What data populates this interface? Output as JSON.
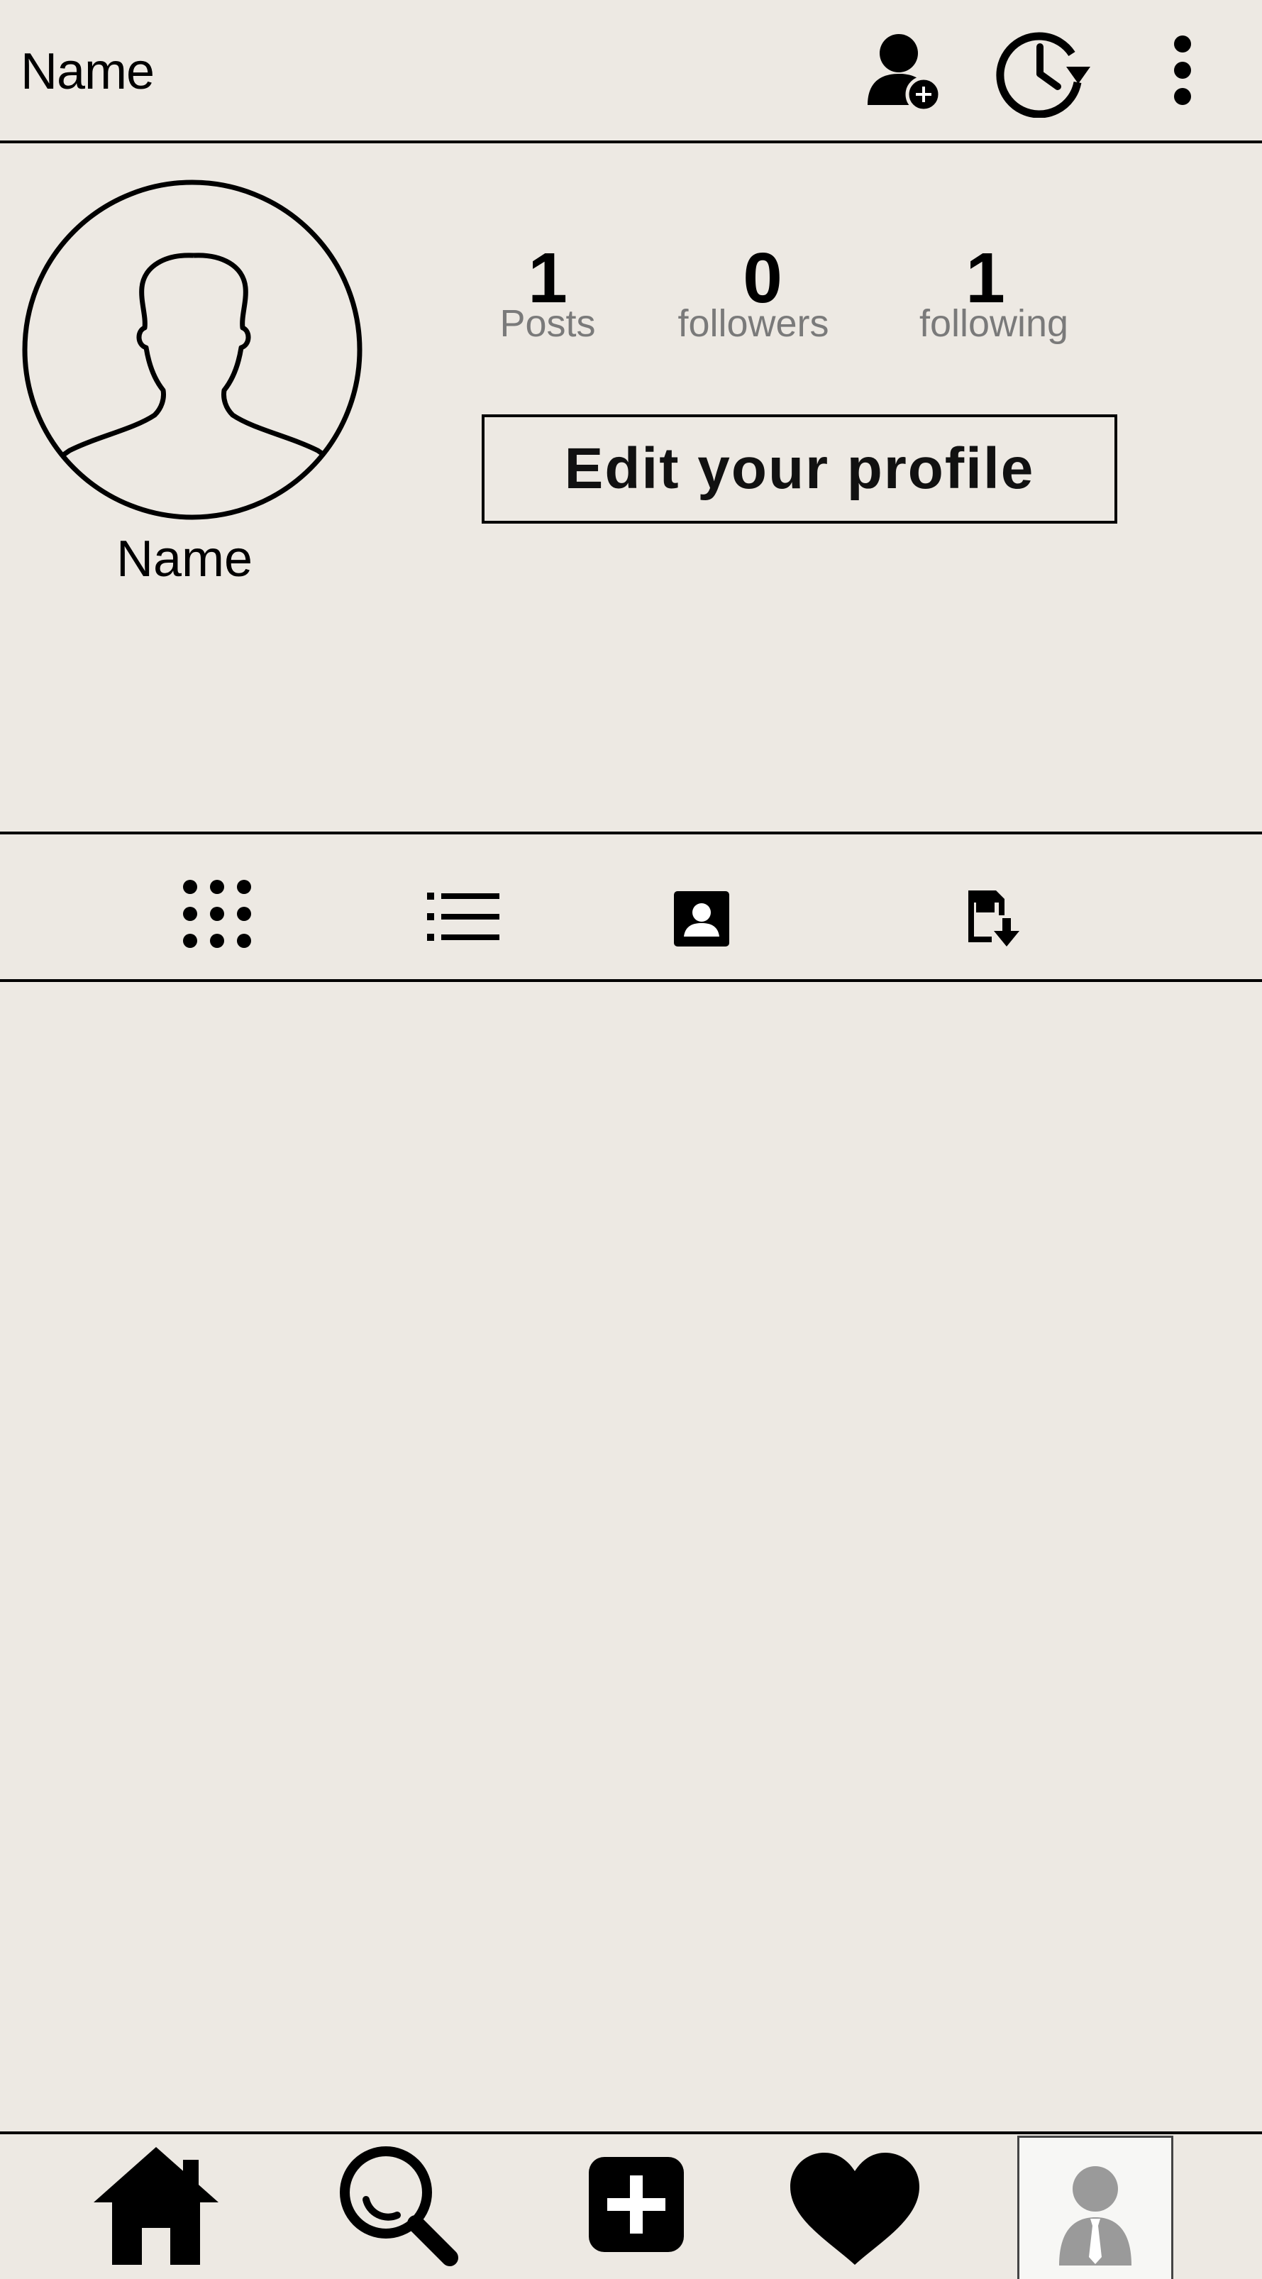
{
  "header": {
    "title": "Name",
    "icons": [
      "add-user-icon",
      "history-icon",
      "more-vertical-icon"
    ]
  },
  "profile": {
    "name": "Name",
    "stats": [
      {
        "value": "1",
        "label": "Posts"
      },
      {
        "value": "0",
        "label": "followers"
      },
      {
        "value": "1",
        "label": "following"
      }
    ],
    "edit_label": "Edit your profile"
  },
  "tabs": [
    "grid-icon",
    "list-icon",
    "tagged-contact-icon",
    "saved-icon"
  ],
  "bottom_nav": [
    "home-icon",
    "search-icon",
    "add-post-icon",
    "heart-icon",
    "profile-avatar-icon"
  ]
}
